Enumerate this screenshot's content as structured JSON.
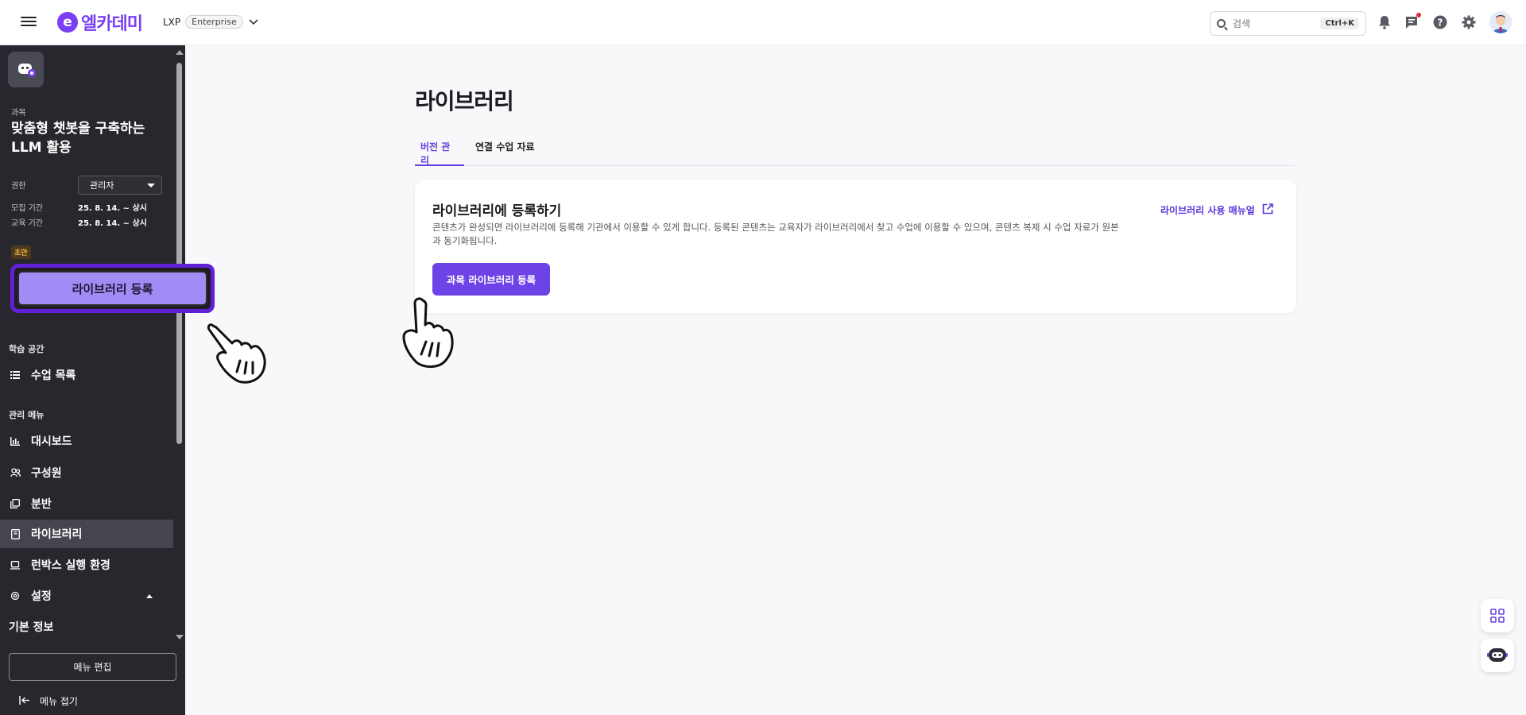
{
  "header": {
    "logo_mark": "e",
    "logo_text": "엘카데미",
    "product": "LXP",
    "plan_badge": "Enterprise",
    "search": {
      "placeholder": "검색",
      "shortcut": "Ctrl+K"
    },
    "icons": [
      "bell-icon",
      "message-icon",
      "help-icon",
      "gear-icon",
      "avatar"
    ]
  },
  "sidebar": {
    "course_caption": "과목",
    "course_title": "맞춤형 챗봇을 구축하는 LLM 활용",
    "role_label": "권한",
    "role_value": "관리자",
    "recruit_label": "모집 기간",
    "recruit_value": "25. 8. 14. ~ 상시",
    "edu_label": "교육 기간",
    "edu_value": "25. 8. 14. ~ 상시",
    "draft_badge": "초안",
    "library_register_button": "라이브러리 등록",
    "section_learning": "학습 공간",
    "items_learning": [
      {
        "label": "수업 목록",
        "icon": "list-icon"
      }
    ],
    "section_admin": "관리 메뉴",
    "items_admin": [
      {
        "label": "대시보드",
        "icon": "chart-icon"
      },
      {
        "label": "구성원",
        "icon": "members-icon"
      },
      {
        "label": "분반",
        "icon": "copy-icon"
      },
      {
        "label": "라이브러리",
        "icon": "library-icon",
        "active": true
      },
      {
        "label": "런박스 실행 환경",
        "icon": "monitor-icon"
      },
      {
        "label": "설정",
        "icon": "settings-icon",
        "expanded": true
      }
    ],
    "sub_item": "기본 정보",
    "menu_edit": "메뉴 편집",
    "menu_fold": "메뉴 접기"
  },
  "main": {
    "title": "라이브러리",
    "tabs": [
      {
        "label": "버전 관리",
        "active": true
      },
      {
        "label": "연결 수업 자료",
        "active": false
      }
    ],
    "card": {
      "title": "라이브러리에 등록하기",
      "description": "콘텐츠가 완성되면 라이브러리에 등록해 기관에서 이용할 수 있게 합니다. 등록된 콘텐츠는 교육자가 라이브러리에서 찾고 수업에 이용할 수 있으며, 콘텐츠 복제 시 수업 자료가 원본과 동기화됩니다.",
      "manual_link": "라이브러리 사용 매뉴얼",
      "button": "과목 라이브러리 등록"
    }
  },
  "colors": {
    "accent": "#6d42e6",
    "sidebar_bg": "#27272d",
    "highlight_border": "#6220d6"
  }
}
